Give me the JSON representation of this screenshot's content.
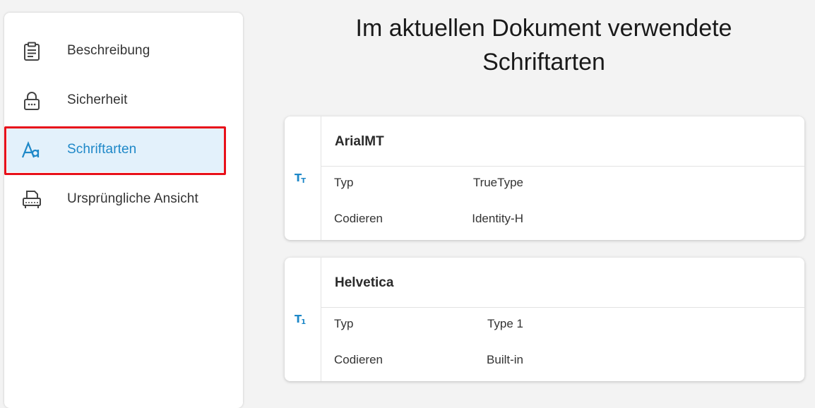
{
  "sidebar": {
    "items": [
      {
        "label": "Beschreibung",
        "icon": "clipboard-icon",
        "active": false
      },
      {
        "label": "Sicherheit",
        "icon": "lock-icon",
        "active": false
      },
      {
        "label": "Schriftarten",
        "icon": "font-icon",
        "active": true
      },
      {
        "label": "Ursprüngliche Ansicht",
        "icon": "printer-icon",
        "active": false
      }
    ]
  },
  "main": {
    "title_line1": "Im aktuellen Dokument verwendete",
    "title_line2": "Schriftarten",
    "fonts": [
      {
        "name": "ArialMT",
        "type_label": "Typ",
        "type_value": "TrueType",
        "encoding_label": "Codieren",
        "encoding_value": "Identity-H",
        "icon": "truetype-icon"
      },
      {
        "name": "Helvetica",
        "type_label": "Typ",
        "type_value": "Type 1",
        "encoding_label": "Codieren",
        "encoding_value": "Built-in",
        "icon": "type1-icon"
      }
    ]
  },
  "colors": {
    "accent": "#1e88c8",
    "active_bg": "#e3f1fb",
    "highlight": "#e8101a",
    "background": "#f3f3f3"
  }
}
